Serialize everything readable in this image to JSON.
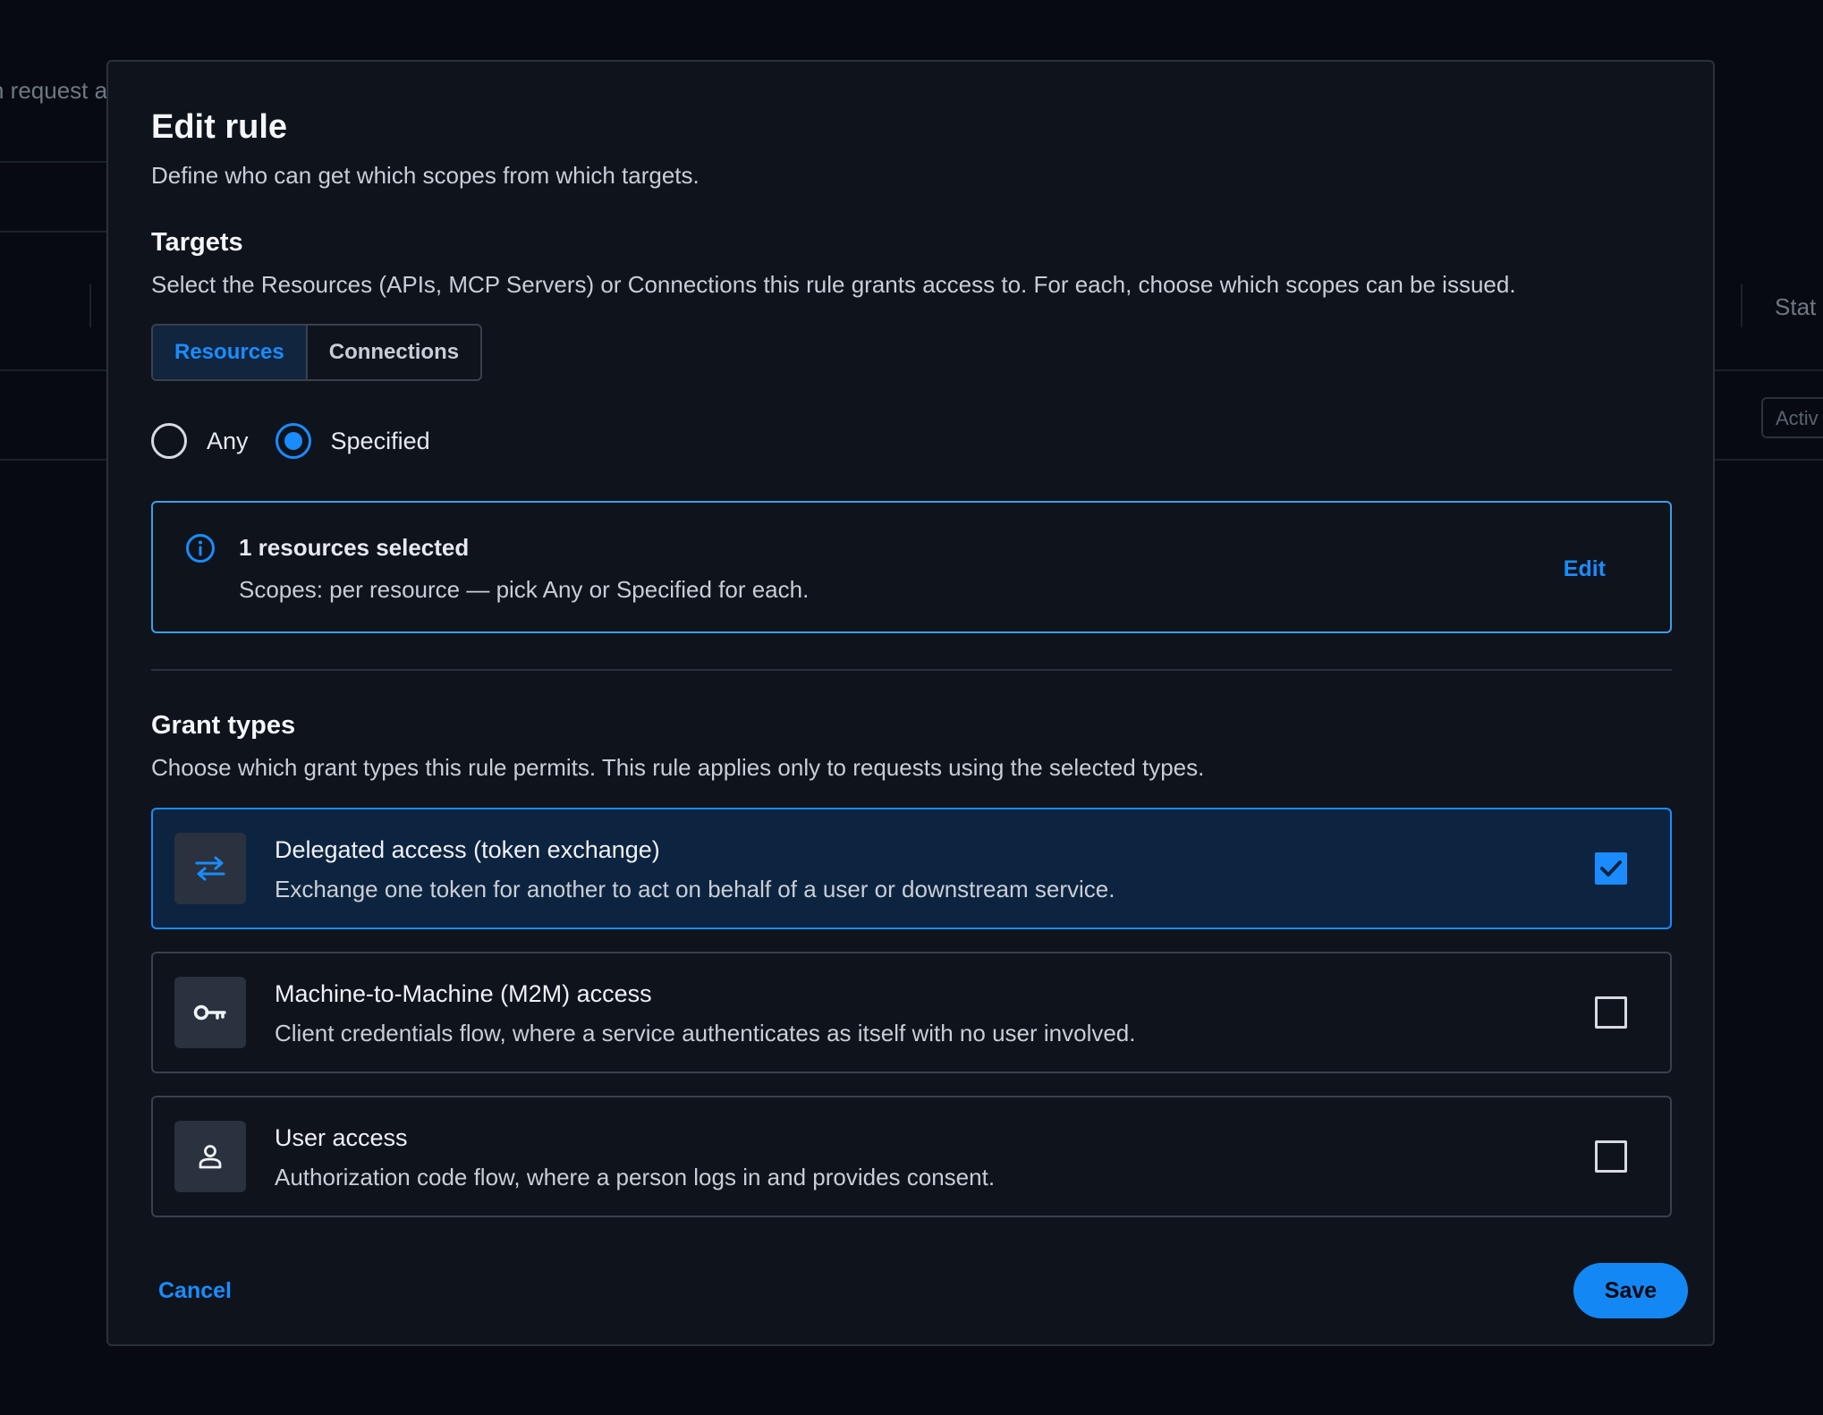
{
  "background": {
    "partial_text_left": "n request a",
    "partial_header_right": "Stat",
    "partial_badge_right": "Activ"
  },
  "modal": {
    "title": "Edit rule",
    "subtitle": "Define who can get which scopes from which targets.",
    "targets": {
      "heading": "Targets",
      "description": "Select the Resources (APIs, MCP Servers) or Connections this rule grants access to. For each, choose which scopes can be issued.",
      "tabs": [
        {
          "label": "Resources",
          "active": true
        },
        {
          "label": "Connections",
          "active": false
        }
      ],
      "radio_options": [
        {
          "label": "Any",
          "checked": false
        },
        {
          "label": "Specified",
          "checked": true
        }
      ],
      "info": {
        "icon": "info-icon",
        "title": "1 resources selected",
        "subtitle": "Scopes: per resource — pick Any or Specified for each.",
        "edit_label": "Edit"
      }
    },
    "grant_types": {
      "heading": "Grant types",
      "description": "Choose which grant types this rule permits. This rule applies only to requests using the selected types.",
      "items": [
        {
          "icon": "swap-arrows-icon",
          "title": "Delegated access (token exchange)",
          "description": "Exchange one token for another to act on behalf of a user or downstream service.",
          "checked": true
        },
        {
          "icon": "key-icon",
          "title": "Machine-to-Machine (M2M) access",
          "description": "Client credentials flow, where a service authenticates as itself with no user involved.",
          "checked": false
        },
        {
          "icon": "user-icon",
          "title": "User access",
          "description": "Authorization code flow, where a person logs in and provides consent.",
          "checked": false
        }
      ]
    },
    "footer": {
      "cancel_label": "Cancel",
      "save_label": "Save"
    }
  },
  "colors": {
    "accent": "#1a8cff",
    "modal_bg": "#0e131c",
    "selected_card_bg": "#0d2440"
  }
}
